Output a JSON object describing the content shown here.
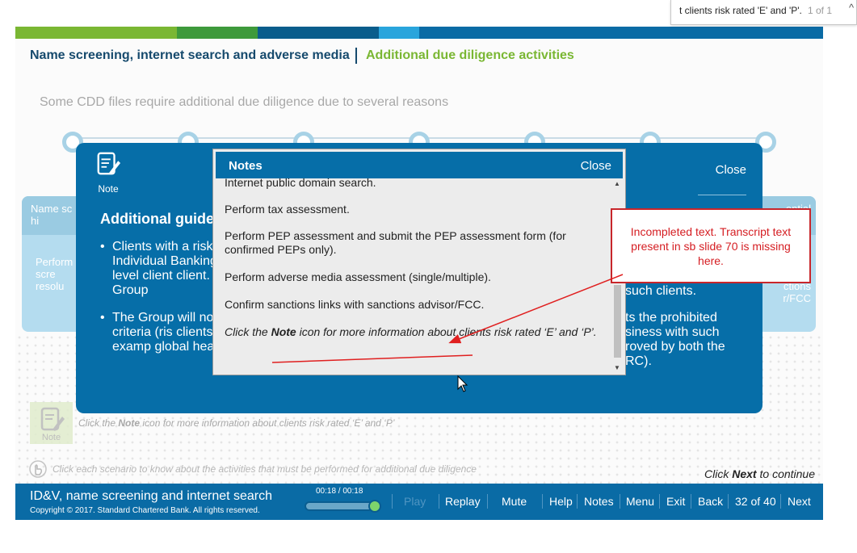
{
  "browser_find": {
    "query": "t clients risk rated 'E' and 'P'.",
    "count": "1 of 1",
    "up_glyph": "^"
  },
  "header": {
    "crumb_section": "Name screening, internet search and adverse media",
    "crumb_current": "Additional due diligence activities",
    "subtitle": "Some CDD files require additional due diligence due to several reasons",
    "stripe_colors": [
      "#7ab733",
      "#3e9a3b",
      "#0a5d8c",
      "#29a5dc",
      "#0a6ba5"
    ]
  },
  "background_cards": {
    "left_header": "Name sc\nhi",
    "left_body": "Perform\nscre\nresolu",
    "right_header": "ential",
    "right_body": "ctions\nr/FCC"
  },
  "modal": {
    "note_label": "Note",
    "close_label": "Close",
    "heading": "Additional guide",
    "bullets": [
      "Clients with a risk Individual Banking Group level client client. The Group",
      "The Group will no clients criteria (ris clients (for examp global head of FC"
    ],
    "right_fragment_1": "such clients.",
    "right_fragment_2": "ts the prohibited\nsiness with such\nroved by both the\nRC)."
  },
  "notes": {
    "title": "Notes",
    "close_label": "Close",
    "items": [
      "Internet public domain search.",
      "Perform tax assessment.",
      "Perform PEP assessment and submit the PEP assessment form (for confirmed PEPs only).",
      "Perform adverse media assessment (single/multiple).",
      "Confirm sanctions links with sanctions advisor/FCC."
    ],
    "instruction_pre": "Click the ",
    "instruction_bold": "Note",
    "instruction_post": " icon for more information about clients risk rated ‘E’ and ‘P’."
  },
  "page_hints": {
    "note_label": "Note",
    "hint_pre": "Click the ",
    "hint_bold": "Note",
    "hint_post": " icon for more information about clients risk rated ‘E’ and ‘P’",
    "scenario_hint": "Click each scenario to know about the activities that must be performed for additional due diligence",
    "continue_pre": "Click ",
    "continue_bold": "Next",
    "continue_post": " to continue"
  },
  "footer": {
    "course_title": "ID&V, name screening and internet search",
    "copyright": "Copyright © 2017. Standard Chartered Bank. All rights reserved.",
    "time": "00:18 / 00:18",
    "progress": 1.0,
    "nav": {
      "play": "Play",
      "replay": "Replay",
      "mute": "Mute",
      "help": "Help",
      "notes": "Notes",
      "menu": "Menu",
      "exit": "Exit",
      "back": "Back",
      "page": "32 of 40",
      "next": "Next"
    }
  },
  "annotation": {
    "text": "Incompleted text. Transcript text present in sb slide 70 is missing here.",
    "color": "#c8262b"
  }
}
